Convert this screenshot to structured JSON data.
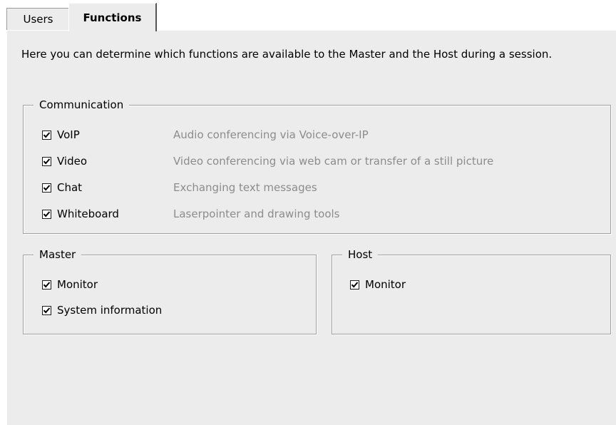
{
  "tabs": [
    {
      "label": "Users",
      "active": false
    },
    {
      "label": "Functions",
      "active": true
    }
  ],
  "intro_text": "Here you can determine which functions are available to the Master and the Host during a session.",
  "groups": {
    "communication": {
      "title": "Communication",
      "items": [
        {
          "label": "VoIP",
          "checked": true,
          "description": "Audio conferencing via Voice-over-IP"
        },
        {
          "label": "Video",
          "checked": true,
          "description": "Video conferencing via web cam or transfer of a still picture"
        },
        {
          "label": "Chat",
          "checked": true,
          "description": "Exchanging text messages"
        },
        {
          "label": "Whiteboard",
          "checked": true,
          "description": "Laserpointer and drawing tools"
        }
      ]
    },
    "master": {
      "title": "Master",
      "items": [
        {
          "label": "Monitor",
          "checked": true
        },
        {
          "label": "System information",
          "checked": true
        }
      ]
    },
    "host": {
      "title": "Host",
      "items": [
        {
          "label": "Monitor",
          "checked": true
        }
      ]
    }
  },
  "colors": {
    "panel_bg": "#ececec",
    "description_text": "#8c8c8c",
    "group_border": "#a0a0a0"
  }
}
